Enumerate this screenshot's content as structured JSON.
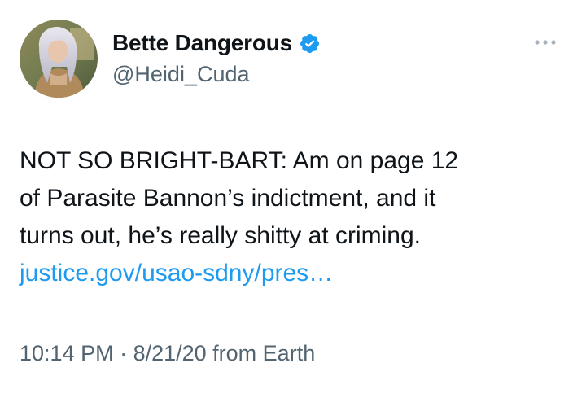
{
  "tweet": {
    "author": {
      "display_name": "Bette Dangerous",
      "handle": "@Heidi_Cuda",
      "verified": true,
      "avatar_icon": "profile-photo"
    },
    "more_icon": "more-horizontal-icon",
    "body_lines": [
      "NOT SO BRIGHT-BART: Am on page 12",
      "of Parasite Bannon’s indictment, and it",
      "turns out, he’s really shitty at criming."
    ],
    "link_text": "justice.gov/usao-sdny/pres…",
    "time": "10:14 PM",
    "separator": " · ",
    "date": "8/21/20",
    "source": " from Earth"
  },
  "colors": {
    "text": "#0f1419",
    "secondary": "#536471",
    "link": "#1d9bf0",
    "verified_badge": "#1d9bf0",
    "divider": "#cfd9de"
  }
}
